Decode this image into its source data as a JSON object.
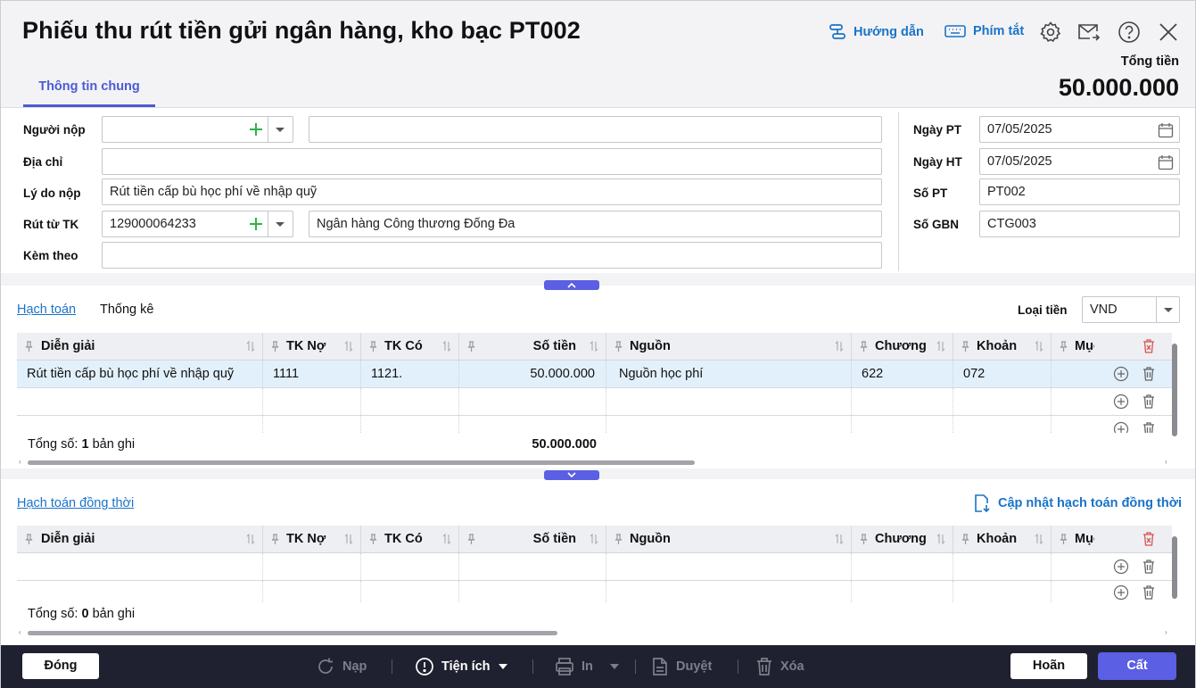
{
  "header": {
    "title": "Phiếu thu rút tiền gửi ngân hàng, kho bạc PT002",
    "guide_label": "Hướng dẫn",
    "shortcut_label": "Phím tắt",
    "total_label": "Tổng tiền",
    "total_value": "50.000.000"
  },
  "tabs": [
    {
      "label": "Thông tin chung"
    }
  ],
  "form": {
    "payer_label": "Người nộp",
    "payer_code": "",
    "payer_name": "",
    "address_label": "Địa chỉ",
    "address": "",
    "reason_label": "Lý do nộp",
    "reason": "Rút tiền cấp bù học phí về nhập quỹ",
    "account_label": "Rút từ TK",
    "account": "129000064233",
    "bank_name": "Ngân hàng Công thương Đống Đa",
    "attach_label": "Kèm theo",
    "attach": "",
    "date_pt_label": "Ngày PT",
    "date_pt": "07/05/2025",
    "date_ht_label": "Ngày HT",
    "date_ht": "07/05/2025",
    "so_pt_label": "Số PT",
    "so_pt": "PT002",
    "so_gbn_label": "Số GBN",
    "so_gbn": "CTG003"
  },
  "accounting": {
    "tab_accounting": "Hạch toán",
    "tab_stats": "Thống kê",
    "currency_label": "Loại tiền",
    "currency": "VND",
    "columns": [
      "Diễn giải",
      "TK Nợ",
      "TK Có",
      "Số tiền",
      "Nguồn",
      "Chương",
      "Khoản",
      "Mục"
    ],
    "rows": [
      {
        "desc": "Rút tiền cấp bù học phí về nhập quỹ",
        "debit": "1111",
        "credit": "1121.",
        "amount": "50.000.000",
        "source": "Nguồn học phí",
        "chapter": "622",
        "section": "072",
        "item": ""
      }
    ],
    "total_prefix": "Tổng số:",
    "total_count": "1",
    "total_suffix": "bản ghi",
    "total_amount": "50.000.000"
  },
  "concurrent": {
    "title": "Hạch toán đồng thời",
    "update_label": "Cập nhật hạch toán đồng thời",
    "columns": [
      "Diễn giải",
      "TK Nợ",
      "TK Có",
      "Số tiền",
      "Nguồn",
      "Chương",
      "Khoản",
      "Mục"
    ],
    "total_prefix": "Tổng số:",
    "total_count": "0",
    "total_suffix": "bản ghi"
  },
  "footer": {
    "close": "Đóng",
    "reload": "Nạp",
    "utilities": "Tiện ích",
    "print": "In",
    "approve": "Duyệt",
    "delete": "Xóa",
    "undo": "Hoãn",
    "save": "Cất"
  },
  "colors": {
    "accent": "#5b5fe3",
    "link": "#1a73c8",
    "footer_bg": "#1f2130",
    "plus": "#2db34a"
  }
}
